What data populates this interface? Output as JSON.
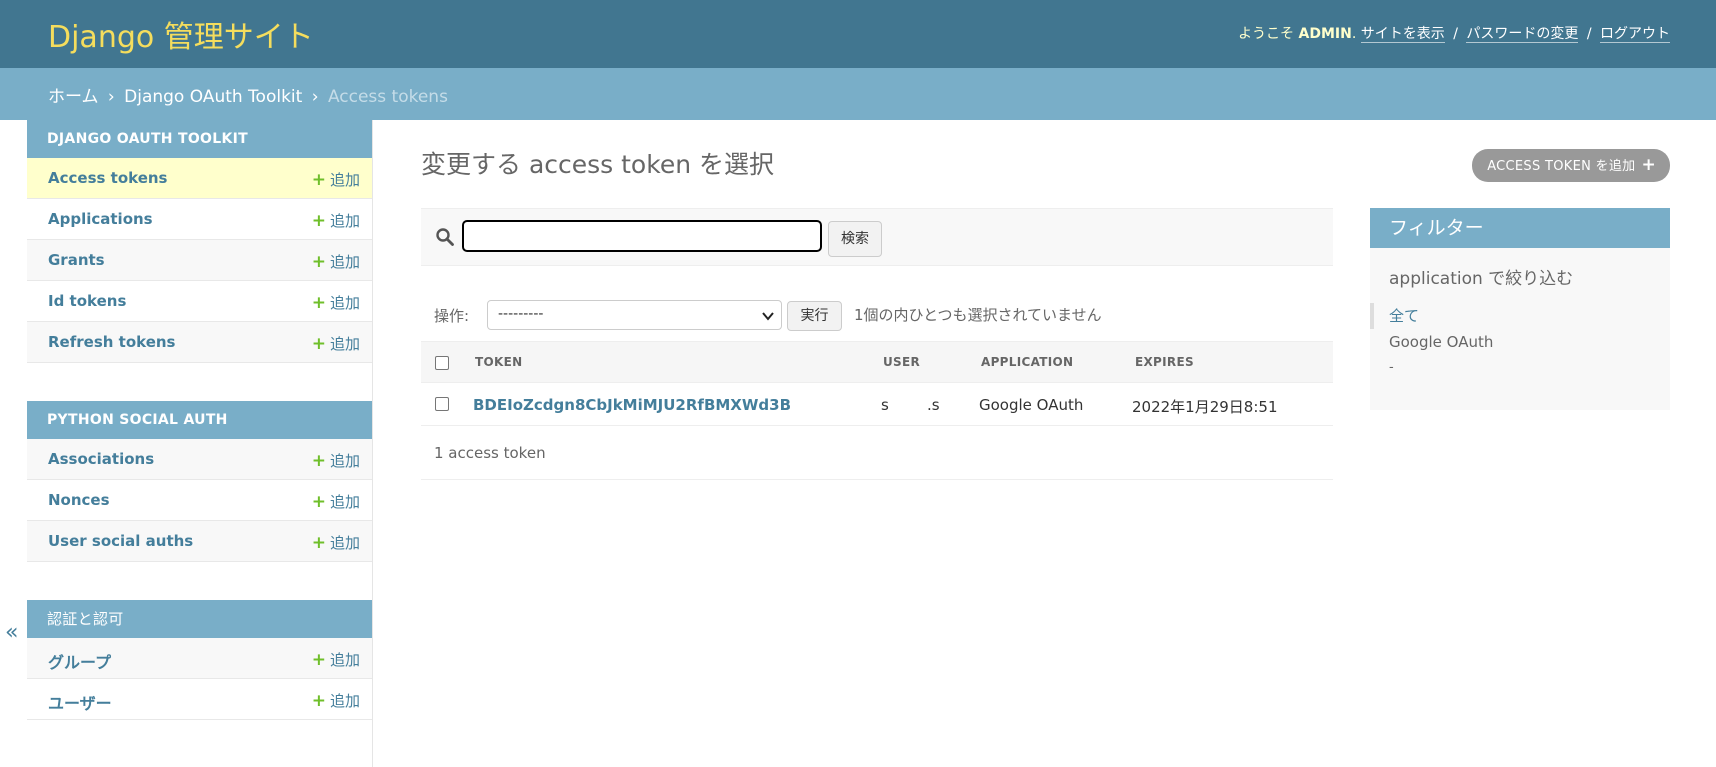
{
  "header": {
    "branding": "Django 管理サイト",
    "welcome": "ようこそ",
    "username": "ADMIN",
    "view_site": "サイトを表示",
    "change_password": "パスワードの変更",
    "logout": "ログアウト",
    "separator": "/"
  },
  "breadcrumbs": {
    "home": "ホーム",
    "app": "Django OAuth Toolkit",
    "current": "Access tokens",
    "separator": "›"
  },
  "sidebar": {
    "collapse_icon": "«",
    "add_label": "追加",
    "modules": [
      {
        "caption": "DJANGO OAUTH TOOLKIT",
        "models": [
          {
            "name": "Access tokens",
            "current": true
          },
          {
            "name": "Applications"
          },
          {
            "name": "Grants"
          },
          {
            "name": "Id tokens"
          },
          {
            "name": "Refresh tokens"
          }
        ]
      },
      {
        "caption": "PYTHON SOCIAL AUTH",
        "models": [
          {
            "name": "Associations"
          },
          {
            "name": "Nonces"
          },
          {
            "name": "User social auths"
          }
        ]
      },
      {
        "caption": "認証と認可",
        "models": [
          {
            "name": "グループ"
          },
          {
            "name": "ユーザー"
          }
        ]
      }
    ]
  },
  "content": {
    "title": "変更する access token を選択",
    "add_button": "ACCESS TOKEN を追加",
    "search": {
      "value": "",
      "button": "検索"
    },
    "actions": {
      "label": "操作:",
      "selected": "---------",
      "run": "実行",
      "counter": "1個の内ひとつも選択されていません"
    },
    "table": {
      "headers": [
        "TOKEN",
        "USER",
        "APPLICATION",
        "EXPIRES"
      ],
      "rows": [
        {
          "token": "BDEIoZcdgn8CbJkMiMJU2RfBMXWd3B",
          "user": "s        .s",
          "application": "Google OAuth",
          "expires": "2022年1月29日8:51"
        }
      ]
    },
    "paginator": "1 access token"
  },
  "filter": {
    "title": "フィルター",
    "subtitle": "application で絞り込む",
    "options": [
      "全て",
      "Google OAuth",
      "-"
    ]
  },
  "colors": {
    "header_bg": "#417690",
    "branding": "#f5dd5d",
    "breadcrumbs_bg": "#79aec8",
    "link": "#447e9b",
    "add_green": "#70bf2b",
    "current_row": "#ffffcc"
  },
  "icons": {
    "search": "search-icon",
    "add": "plus-icon",
    "collapse": "double-chevron-left-icon",
    "select": "chevron-down-icon"
  }
}
